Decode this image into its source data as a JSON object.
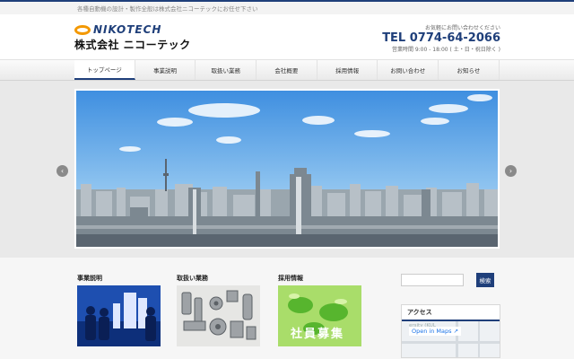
{
  "top_bar": {
    "tagline": "各種自動機の設計・製作全般は株式会社ニコーテックにお任せ下さい"
  },
  "header": {
    "logo_en": "NIKOTECH",
    "logo_ja": "株式会社 ニコーテック",
    "contact_prompt": "お気軽にお問い合わせください",
    "tel": "TEL 0774-64-2066",
    "hours": "営業時間 9:00 - 18:00 ( 土・日・祝日除く )"
  },
  "nav": {
    "items": [
      {
        "label": "トップページ"
      },
      {
        "label": "事業説明"
      },
      {
        "label": "取扱い業務"
      },
      {
        "label": "会社概要"
      },
      {
        "label": "採用情報"
      },
      {
        "label": "お問い合わせ"
      },
      {
        "label": "お知らせ"
      }
    ]
  },
  "slider": {
    "prev_glyph": "‹",
    "next_glyph": "›"
  },
  "cards": [
    {
      "title": "事業説明"
    },
    {
      "title": "取扱い業務"
    },
    {
      "title": "採用情報",
      "banner_text": "社員募集"
    }
  ],
  "sidebar": {
    "search_placeholder": "",
    "search_button": "検索",
    "access_title": "アクセス",
    "map_label": "ersity (KUL",
    "map_open": "Open in Maps ↗"
  },
  "colors": {
    "accent": "#1f3f7a",
    "logo_orange": "#f39800"
  }
}
